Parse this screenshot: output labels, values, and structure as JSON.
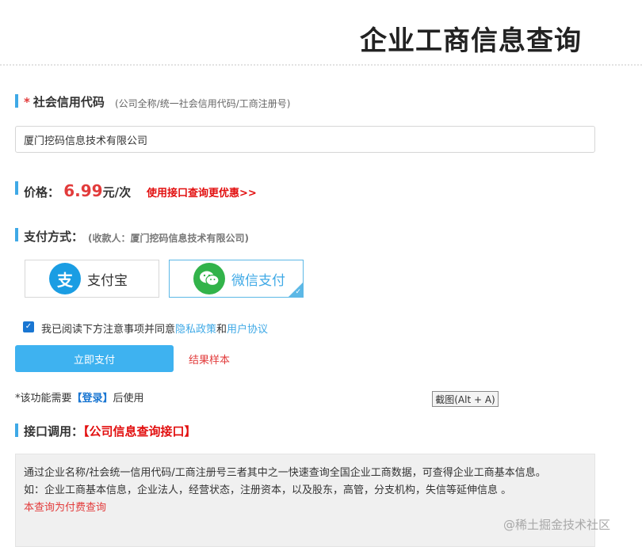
{
  "header": {
    "title": "企业工商信息查询"
  },
  "credit_code": {
    "required_mark": "*",
    "label": "社会信用代码",
    "hint": "(公司全称/统一社会信用代码/工商注册号)",
    "input_value": "厦门挖码信息技术有限公司"
  },
  "price": {
    "label": "价格：",
    "value": "6.99",
    "unit": "元/次",
    "api_promo": "使用接口查询更优惠>>"
  },
  "payment": {
    "label": "支付方式：",
    "payee": "(收款人：厦门挖码信息技术有限公司)",
    "options": [
      {
        "label": "支付宝",
        "icon": "alipay-icon",
        "glyph": "支",
        "selected": false
      },
      {
        "label": "微信支付",
        "icon": "wechat-icon",
        "glyph": "◕",
        "selected": true
      }
    ]
  },
  "agreement": {
    "checked": true,
    "text_before": "我已阅读下方注意事项并同意",
    "privacy_link": "隐私政策",
    "conjunction": "和",
    "user_link": "用户协议"
  },
  "actions": {
    "pay_now": "立即支付",
    "sample": "结果样本"
  },
  "login_note": {
    "prefix": "*该功能需要",
    "link": "【登录】",
    "suffix": "后使用"
  },
  "screenshot_tip": "截图(Alt + A)",
  "api_section": {
    "label": "接口调用：",
    "link": "【公司信息查询接口】"
  },
  "info": {
    "line1": "通过企业名称/社会统一信用代码/工商注册号三者其中之一快速查询全国企业工商数据，可查得企业工商基本信息。",
    "line2": "如：企业工商基本信息，企业法人，经营状态，注册资本，以及股东，高管，分支机构，失信等延伸信息 。",
    "note": "本查询为付费查询"
  },
  "watermark": "@稀土掘金技术社区",
  "colors": {
    "accent": "#3fa9e6",
    "price_red": "#e23b3b",
    "button": "#3eb2f0",
    "alipay": "#1a9de3",
    "wechat": "#32b34a"
  }
}
